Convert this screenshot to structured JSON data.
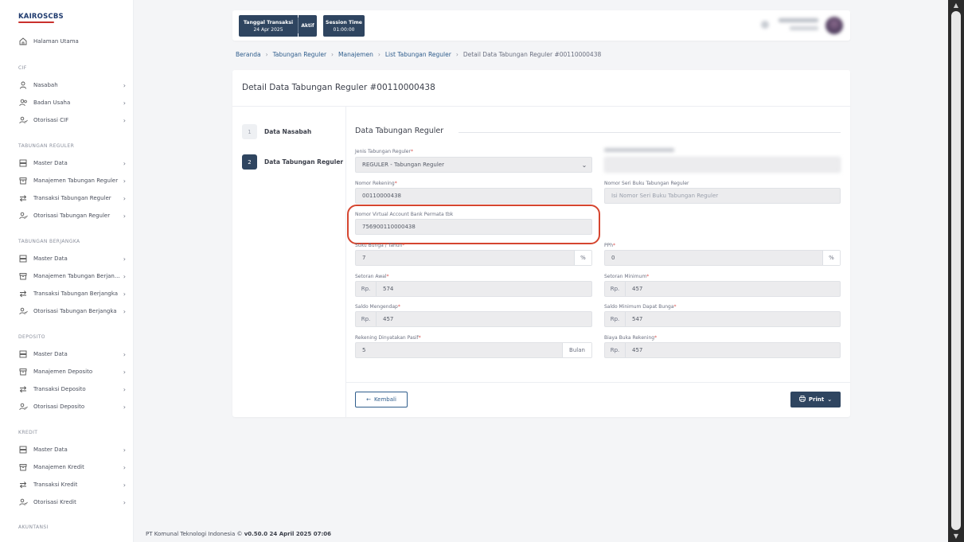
{
  "sidebar": {
    "logo": "KAIROSCBS",
    "home": "Halaman Utama",
    "sections": [
      {
        "title": "CIF",
        "items": [
          {
            "label": "Nasabah",
            "icon": "user-icon"
          },
          {
            "label": "Badan Usaha",
            "icon": "users-icon"
          },
          {
            "label": "Otorisasi CIF",
            "icon": "user-check-icon"
          }
        ]
      },
      {
        "title": "TABUNGAN REGULER",
        "items": [
          {
            "label": "Master Data",
            "icon": "server-icon"
          },
          {
            "label": "Manajemen Tabungan Reguler",
            "icon": "archive-icon"
          },
          {
            "label": "Transaksi Tabungan Reguler",
            "icon": "transfer-icon"
          },
          {
            "label": "Otorisasi Tabungan Reguler",
            "icon": "user-check-icon"
          }
        ]
      },
      {
        "title": "TABUNGAN BERJANGKA",
        "items": [
          {
            "label": "Master Data",
            "icon": "server-icon"
          },
          {
            "label": "Manajemen Tabungan Berjan...",
            "icon": "archive-icon"
          },
          {
            "label": "Transaksi Tabungan Berjangka",
            "icon": "transfer-icon"
          },
          {
            "label": "Otorisasi Tabungan Berjangka",
            "icon": "user-check-icon"
          }
        ]
      },
      {
        "title": "DEPOSITO",
        "items": [
          {
            "label": "Master Data",
            "icon": "server-icon"
          },
          {
            "label": "Manajemen Deposito",
            "icon": "archive-icon"
          },
          {
            "label": "Transaksi Deposito",
            "icon": "transfer-icon"
          },
          {
            "label": "Otorisasi Deposito",
            "icon": "user-check-icon"
          }
        ]
      },
      {
        "title": "KREDIT",
        "items": [
          {
            "label": "Master Data",
            "icon": "server-icon"
          },
          {
            "label": "Manajemen Kredit",
            "icon": "archive-icon"
          },
          {
            "label": "Transaksi Kredit",
            "icon": "transfer-icon"
          },
          {
            "label": "Otorisasi Kredit",
            "icon": "user-check-icon"
          }
        ]
      },
      {
        "title": "AKUNTANSI",
        "items": []
      }
    ]
  },
  "topbar": {
    "tanggal_label": "Tanggal Transaksi",
    "tanggal_value": "24 Apr 2025",
    "aktif": "Aktif",
    "session_label": "Session Time",
    "session_value": "01:00:00"
  },
  "breadcrumb": {
    "items": [
      "Beranda",
      "Tabungan Reguler",
      "Manajemen",
      "List Tabungan Reguler"
    ],
    "current": "Detail Data Tabungan Reguler #00110000438"
  },
  "card": {
    "title": "Detail Data Tabungan Reguler #00110000438",
    "steps": [
      {
        "num": "1",
        "label": "Data Nasabah"
      },
      {
        "num": "2",
        "label": "Data Tabungan Reguler"
      }
    ],
    "section_title": "Data Tabungan Reguler"
  },
  "form": {
    "jenis": {
      "label": "Jenis Tabungan Reguler",
      "value": "REGULER - Tabungan Reguler"
    },
    "nomor_rekening": {
      "label": "Nomor Rekening",
      "value": "00110000438"
    },
    "nomor_seri": {
      "label": "Nomor Seri Buku Tabungan Reguler",
      "placeholder": "Isi Nomor Seri Buku Tabungan Reguler"
    },
    "virtual_account": {
      "label": "Nomor Virtual Account Bank Permata tbk",
      "value": "756900110000438"
    },
    "suku_bunga": {
      "label": "Suku Bunga / Tahun",
      "value": "7",
      "suffix": "%"
    },
    "pph": {
      "label": "PPh",
      "value": "0",
      "suffix": "%"
    },
    "setoran_awal": {
      "label": "Setoran Awal",
      "prefix": "Rp.",
      "value": "574"
    },
    "setoran_minimum": {
      "label": "Setoran Minimum",
      "prefix": "Rp.",
      "value": "457"
    },
    "saldo_mengendap": {
      "label": "Saldo Mengendap",
      "prefix": "Rp.",
      "value": "457"
    },
    "saldo_min_bunga": {
      "label": "Saldo Minimum Dapat Bunga",
      "prefix": "Rp.",
      "value": "547"
    },
    "rekening_pasif": {
      "label": "Rekening Dinyatakan Pasif",
      "value": "5",
      "suffix": "Bulan"
    },
    "biaya_buka": {
      "label": "Biaya Buka Rekening",
      "prefix": "Rp.",
      "value": "457"
    }
  },
  "buttons": {
    "back": "Kembali",
    "print": "Print"
  },
  "footer": {
    "company": "PT Komunal Teknologi Indonesia ©",
    "version": "v0.50.0 24 April 2025 07:06"
  }
}
